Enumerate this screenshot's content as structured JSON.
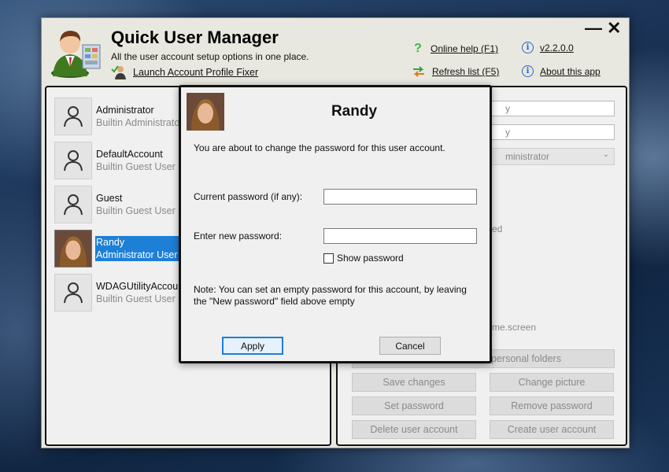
{
  "app": {
    "title": "Quick User Manager",
    "subtitle": "All the user account setup options in one place.",
    "launch_link": "Launch Account Profile Fixer",
    "online_help": "Online help (F1)",
    "refresh": "Refresh list (F5)",
    "version": "v2.2.0.0",
    "about": "About this app",
    "minimize": "—",
    "close": "✕"
  },
  "users": [
    {
      "name": "Administrator",
      "role": "Builtin Administrator"
    },
    {
      "name": "DefaultAccount",
      "role": "Builtin Guest User"
    },
    {
      "name": "Guest",
      "role": "Builtin Guest User"
    },
    {
      "name": "Randy",
      "role": "Administrator User"
    },
    {
      "name": "WDAGUtilityAccount",
      "role": "Builtin Guest User"
    }
  ],
  "right_panel": {
    "field1_tail": "y",
    "field2_tail": "y",
    "account_type_tail": "ministrator",
    "status_tail": "ed",
    "screen_tail": "me.screen",
    "buttons": {
      "personal_folders": "personal folders",
      "save_changes": "Save changes",
      "change_picture": "Change picture",
      "set_password": "Set password",
      "remove_password": "Remove password",
      "delete_user": "Delete user account",
      "create_user": "Create user account"
    }
  },
  "dialog": {
    "title": "Randy",
    "intro": "You are about to change the password for this user account.",
    "current_label": "Current password (if any):",
    "new_label": "Enter new password:",
    "show_password": "Show password",
    "note_line1": "Note: You can set an empty password for this account, by leaving",
    "note_line2": "the \"New password\" field above empty",
    "apply": "Apply",
    "cancel": "Cancel",
    "current_value": "",
    "new_value": ""
  },
  "colors": {
    "selection": "#1e7fd6",
    "help_icon": "#3db34a",
    "info_icon": "#2a63c9"
  }
}
